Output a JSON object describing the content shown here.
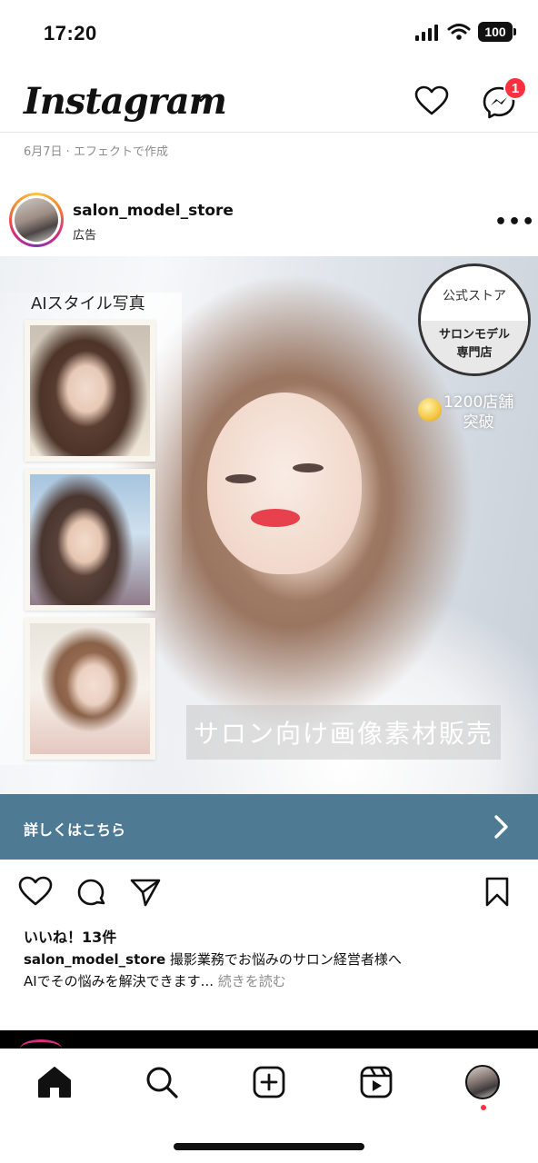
{
  "status_bar": {
    "time": "17:20",
    "battery": "100"
  },
  "header": {
    "app_title": "Instagram",
    "notification_count": "1"
  },
  "effect_note": "6月7日 · エフェクトで作成",
  "post": {
    "username": "salon_model_store",
    "sponsored_label": "広告",
    "more_label": "•••",
    "ad": {
      "ai_label": "AIスタイル写真",
      "badge_top": "公式ストア",
      "badge_line1": "サロンモデル",
      "badge_line2": "専門店",
      "store_count_line1": "1200店舗",
      "store_count_line2": "突破",
      "caption": "サロン向け画像素材販売"
    },
    "cta_label": "詳しくはこちら",
    "likes": "いいね！13件",
    "caption_user": "salon_model_store",
    "caption_text1": " 撮影業務でお悩みのサロン経営者様へ",
    "caption_text2": "AIでその悩みを解決できます...",
    "read_more": " 続きを読む"
  },
  "icons": {
    "header": [
      "chevron-down-icon",
      "heart-icon",
      "messenger-icon"
    ],
    "actions": [
      "heart-icon",
      "comment-icon",
      "share-icon",
      "bookmark-icon"
    ],
    "nav": [
      "home-icon",
      "search-icon",
      "create-icon",
      "reels-icon",
      "profile-avatar"
    ]
  },
  "colors": {
    "cta": "#4e7a94",
    "badge": "#ff3040",
    "text": "#111111"
  }
}
